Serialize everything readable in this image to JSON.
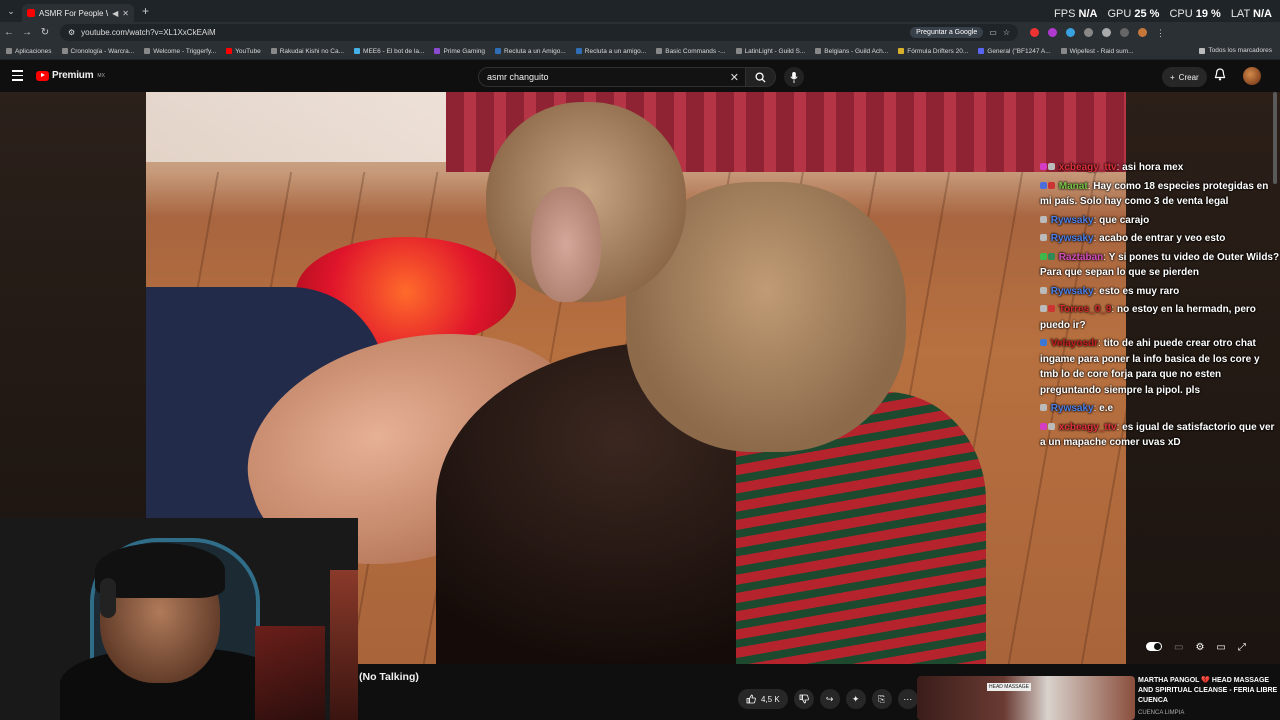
{
  "browser": {
    "tab_title": "ASMR For People Who NE",
    "url": "youtube.com/watch?v=XL1XxCkEAiM",
    "google_pill": "Preguntar a Google",
    "stats": [
      {
        "label": "FPS",
        "value": "N/A"
      },
      {
        "label": "GPU",
        "value": "25 %"
      },
      {
        "label": "CPU",
        "value": "19 %"
      },
      {
        "label": "LAT",
        "value": "N/A"
      }
    ],
    "bookmarks": [
      "Aplicaciones",
      "Cronología - Warcra...",
      "Welcome - Triggerfy...",
      "YouTube",
      "Rakudai Kishi no Ca...",
      "MEE6 - El bot de la...",
      "Prime Gaming",
      "Recluta a un Amigo...",
      "Recluta a un amigo...",
      "Basic Commands -...",
      "LatinLight - Guild S...",
      "Belgians - Guild Ach...",
      "Fórmula Drifters 20...",
      "General (\"BF1247 A...",
      "Wipefest - Raid sum..."
    ],
    "bookmarks_right": "Todos los marcadores"
  },
  "youtube": {
    "logo_text": "Premium",
    "logo_region": "MX",
    "search_value": "asmr changuito",
    "create_label": "Crear"
  },
  "chat": [
    {
      "user": "xcbeagy_ttv",
      "user_color": "#e0303a",
      "badge": "#d43cc3",
      "text": "asi hora mex"
    },
    {
      "user": "Manat",
      "user_color": "#78c447",
      "badge": "#4a6fdc",
      "text": "Hay como 18 especies protegidas en mi país. Solo hay como 3 de venta legal"
    },
    {
      "user": "Rywsaky",
      "user_color": "#4a7fe8",
      "badge": "#bbbbbb",
      "text": "que carajo"
    },
    {
      "user": "Rywsaky",
      "user_color": "#4a7fe8",
      "badge": "#bbbbbb",
      "text": "acabo de entrar y veo esto"
    },
    {
      "user": "Raztaban",
      "user_color": "#d44dc0",
      "badge": "#3fb84a",
      "text": "Y si pones tu video de Outer Wilds? Para que sepan lo que se pierden"
    },
    {
      "user": "Rywsaky",
      "user_color": "#4a7fe8",
      "badge": "#bbbbbb",
      "text": "esto es muy raro"
    },
    {
      "user": "Torres_0_9",
      "user_color": "#d42a2a",
      "badge": "#bbbbbb",
      "text": "no estoy en la hermadn, pero puedo ir?"
    },
    {
      "user": "Velayosdr",
      "user_color": "#c41f1f",
      "badge": "#3a78d6",
      "text": "tito de ahi puede crear otro chat ingame para poner la info basica de los core y tmb lo de core forja para que no esten preguntando siempre la pipol. pls"
    },
    {
      "user": "Rywsaky",
      "user_color": "#4a7fe8",
      "badge": "#bbbbbb",
      "text": "e.e"
    },
    {
      "user": "xcbeagy_ttv",
      "user_color": "#e0303a",
      "badge": "#d43cc3",
      "text": "es igual de satisfactorio que ver a un mapache comer uvas xD"
    }
  ],
  "video": {
    "title_fragment": "(No Talking)",
    "likes": "4,5 K"
  },
  "recommended": {
    "title": "MARTHA PANGOL 💔 HEAD MASSAGE AND SPIRITUAL CLEANSE - FERIA LIBRE CUENCA",
    "channel": "CUENCA LIMPIA",
    "thumb_text": "HEAD MASSAGE"
  }
}
